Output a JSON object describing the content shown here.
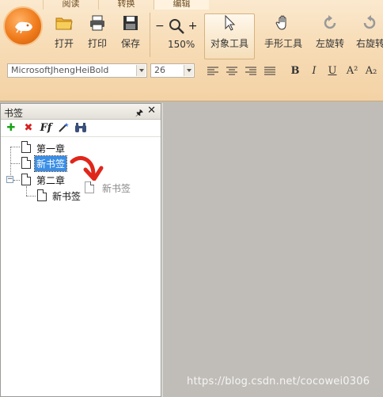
{
  "ribbon": {
    "tabs": [
      {
        "label": "阅读",
        "active": false
      },
      {
        "label": "转换",
        "active": false
      },
      {
        "label": "编辑",
        "active": true
      }
    ],
    "tools": {
      "open": "打开",
      "print": "打印",
      "save": "保存",
      "zoom_value": "150%",
      "object_tool": "对象工具",
      "hand_tool": "手形工具",
      "rotate_left": "左旋转",
      "rotate_right": "右旋转"
    },
    "font_name": "MicrosoftJhengHeiBold",
    "font_size": "26",
    "format_buttons": {
      "bold": "B",
      "italic": "I",
      "underline": "U",
      "superscript": "A²",
      "subscript": "A₂"
    }
  },
  "bookmarks": {
    "title": "书签",
    "tree": [
      {
        "label": "第一章"
      },
      {
        "label": "新书签",
        "selected": true
      },
      {
        "label": "第二章",
        "expanded": true,
        "children": [
          {
            "label": "新书签"
          }
        ]
      }
    ],
    "drag_ghost_label": "新书签"
  },
  "watermark": "https://blog.csdn.net/cocowei0306",
  "colors": {
    "accent": "#f07b1c",
    "selection": "#3a8ee6",
    "annotation_arrow": "#e0261b",
    "document_bg": "#c0bdb8"
  }
}
